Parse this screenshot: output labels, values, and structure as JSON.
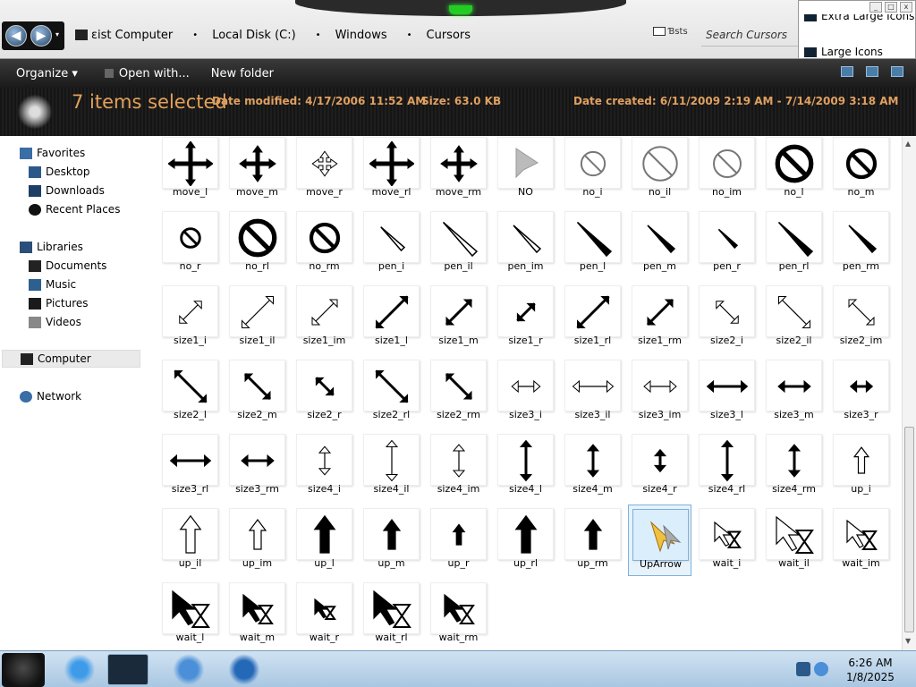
{
  "window": {
    "address_parts": [
      "ɛist Computer",
      "Local Disk (C:)",
      "Windows",
      "Cursors"
    ],
    "refresh_label": "Ɓsts",
    "search_placeholder": "Search Cursors",
    "search_extra": ":)",
    "view_menu_items": [
      "Extra Large Icons",
      "Large Icons"
    ]
  },
  "toolbar": {
    "organize": "Organize ▾",
    "open_with": "Open with...",
    "new_folder": "New folder"
  },
  "details": {
    "selection": "7 items selected",
    "date_modified_label": "Date modified:",
    "date_modified": "4/17/2006 11:52 AM",
    "size_label": "Size:",
    "size": "63.0 KB",
    "date_created_label": "Date created:",
    "date_created": "6/11/2009 2:19 AM - 7/14/2009 3:18 AM"
  },
  "nav": {
    "favorites": "Favorites",
    "desktop": "Desktop",
    "downloads": "Downloads",
    "recent": "Recent Places",
    "libraries": "Libraries",
    "documents": "Documents",
    "music": "Music",
    "pictures": "Pictures",
    "videos": "Videos",
    "computer": "Computer",
    "network": "Network"
  },
  "files": [
    [
      "move_l",
      "move_m",
      "move_r",
      "move_rl",
      "move_rm",
      "NO",
      "no_i",
      "no_il",
      "no_im",
      "no_l",
      "no_m"
    ],
    [
      "no_r",
      "no_rl",
      "no_rm",
      "pen_i",
      "pen_il",
      "pen_im",
      "pen_l",
      "pen_m",
      "pen_r",
      "pen_rl",
      "pen_rm"
    ],
    [
      "size1_i",
      "size1_il",
      "size1_im",
      "size1_l",
      "size1_m",
      "size1_r",
      "size1_rl",
      "size1_rm",
      "size2_i",
      "size2_il",
      "size2_im"
    ],
    [
      "size2_l",
      "size2_m",
      "size2_r",
      "size2_rl",
      "size2_rm",
      "size3_i",
      "size3_il",
      "size3_im",
      "size3_l",
      "size3_m",
      "size3_r"
    ],
    [
      "size3_rl",
      "size3_rm",
      "size4_i",
      "size4_il",
      "size4_im",
      "size4_l",
      "size4_m",
      "size4_r",
      "size4_rl",
      "size4_rm",
      "up_i"
    ],
    [
      "up_il",
      "up_im",
      "up_l",
      "up_m",
      "up_r",
      "up_rl",
      "up_rm",
      "UpArrow",
      "wait_i",
      "wait_il",
      "wait_im"
    ],
    [
      "wait_l",
      "wait_m",
      "wait_r",
      "wait_rl",
      "wait_rm"
    ]
  ],
  "selected_file": "UpArrow",
  "taskbar": {
    "time": "6:26 AM",
    "date": "1/8/2025"
  }
}
